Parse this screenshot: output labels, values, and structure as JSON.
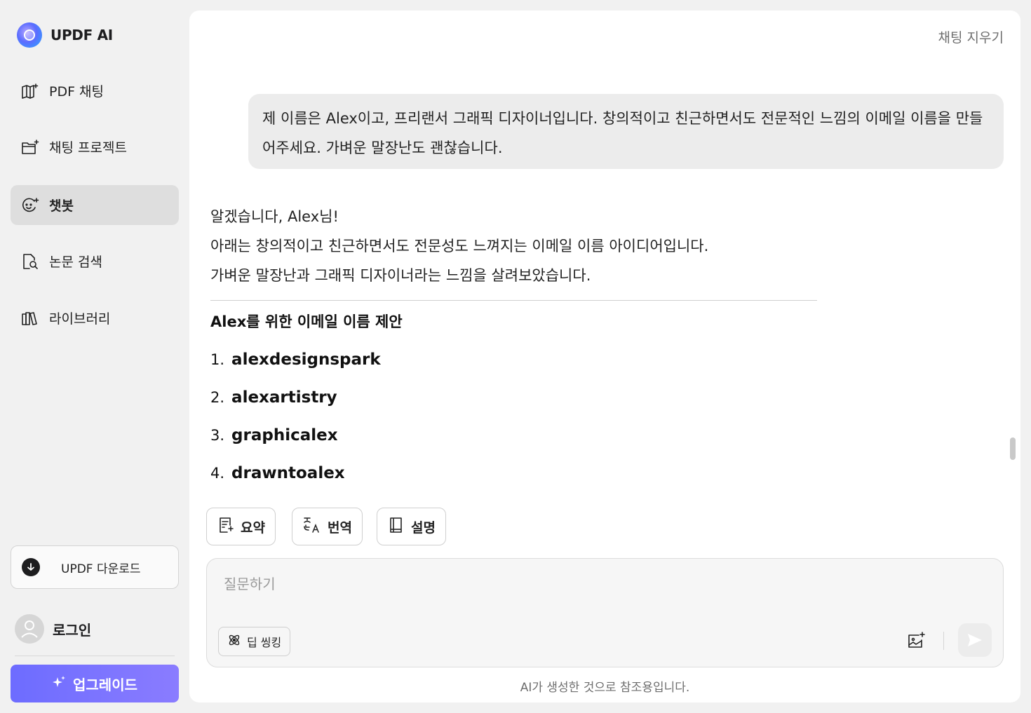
{
  "app": {
    "name": "UPDF AI"
  },
  "sidebar": {
    "items": [
      {
        "label": "PDF 채팅",
        "icon": "book-sparkle-icon"
      },
      {
        "label": "채팅 프로젝트",
        "icon": "folder-sparkle-icon"
      },
      {
        "label": "챗봇",
        "icon": "chatbot-face-icon",
        "active": true
      },
      {
        "label": "논문 검색",
        "icon": "document-search-icon"
      },
      {
        "label": "라이브러리",
        "icon": "library-icon"
      }
    ],
    "download_label": "UPDF 다운로드",
    "login_label": "로그인",
    "upgrade_label": "업그레이드"
  },
  "header": {
    "clear_chat": "채팅 지우기"
  },
  "conversation": {
    "user_message": "제 이름은 Alex이고, 프리랜서 그래픽 디자이너입니다. 창의적이고 친근하면서도 전문적인 느낌의 이메일 이름을 만들어주세요. 가벼운 말장난도 괜찮습니다.",
    "reply_lines": [
      "알겠습니다, Alex님!",
      "아래는 창의적이고 친근하면서도 전문성도 느껴지는 이메일 이름 아이디어입니다.",
      "가벼운 말장난과 그래픽 디자이너라는 느낌을 살려보았습니다."
    ],
    "reply_heading": "Alex를 위한 이메일 이름 제안",
    "suggestions": [
      {
        "num": "1.",
        "name": "alexdesignspark"
      },
      {
        "num": "2.",
        "name": "alexartistry"
      },
      {
        "num": "3.",
        "name": "graphicalex"
      },
      {
        "num": "4.",
        "name": "drawntoalex"
      }
    ]
  },
  "quick_actions": [
    {
      "label": "요약",
      "icon": "summary-icon"
    },
    {
      "label": "번역",
      "icon": "translate-icon"
    },
    {
      "label": "설명",
      "icon": "book-icon"
    }
  ],
  "composer": {
    "placeholder": "질문하기",
    "deep_think_label": "딥 씽킹"
  },
  "footer": {
    "disclaimer": "AI가 생성한 것으로 참조용입니다."
  }
}
